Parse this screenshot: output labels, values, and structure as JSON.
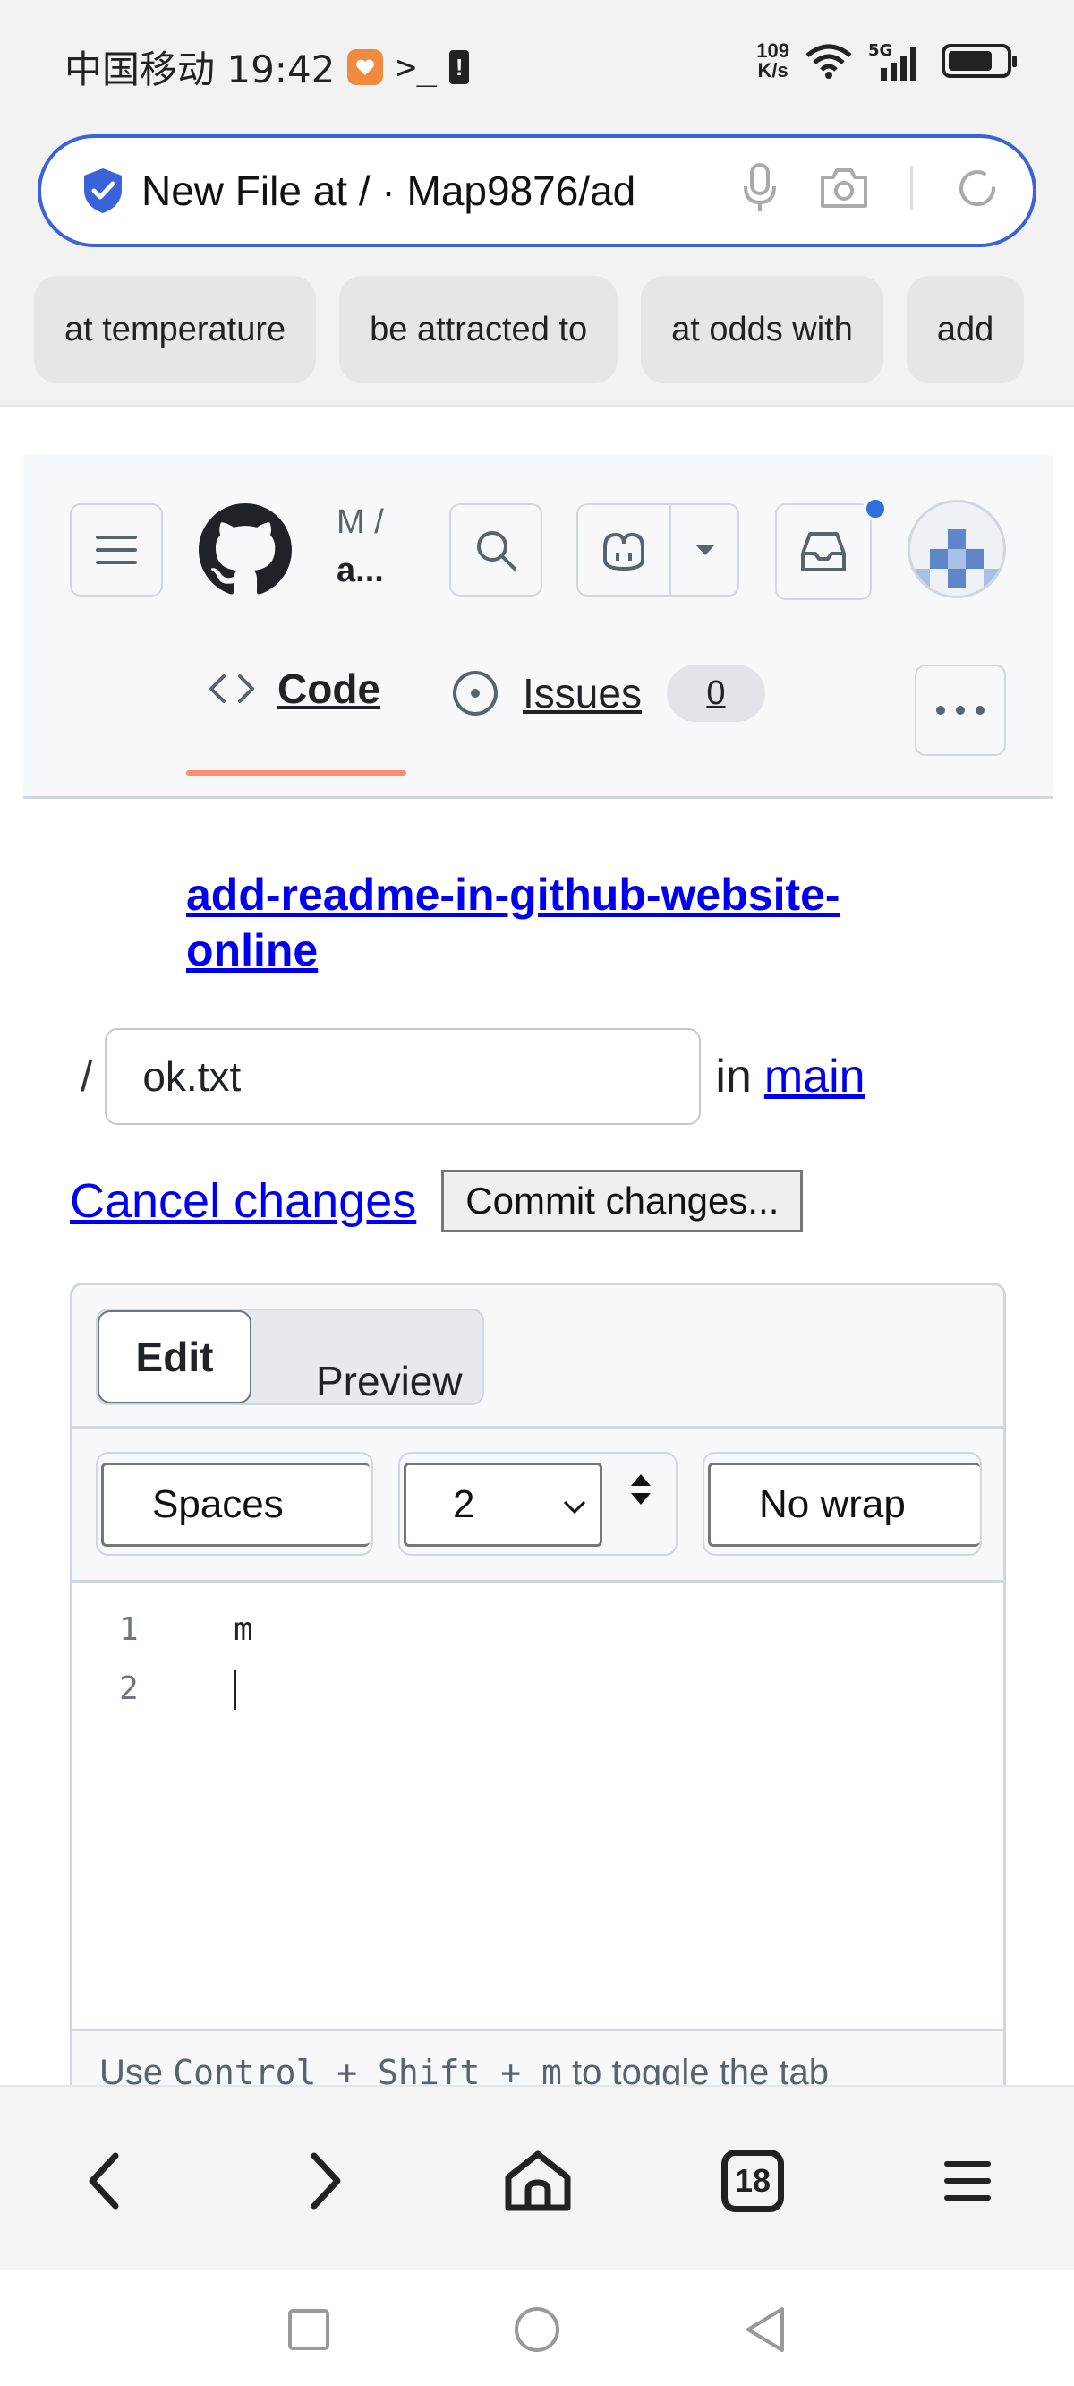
{
  "status_bar": {
    "carrier_time": "中国移动 19:42",
    "terminal_glyph": ">_",
    "net_speed_value": "109",
    "net_speed_unit": "K/s",
    "network_type": "5G"
  },
  "browser": {
    "url_text": "New File at / · Map9876/ad",
    "suggestions": [
      "at temperature",
      "be attracted to",
      "at odds with",
      "add"
    ]
  },
  "github": {
    "owner": "M /",
    "repo": "a...",
    "tabs": [
      {
        "label": "Code"
      },
      {
        "label": "Issues",
        "count": "0"
      }
    ]
  },
  "editor_page": {
    "branch_link": "add-readme-in-github-website-online",
    "path_slash": "/",
    "filename": "ok.txt",
    "in_text": "in",
    "branch_name": "main",
    "cancel_label": "Cancel changes",
    "commit_label": "Commit changes...",
    "edit_tab": "Edit",
    "preview_tab": "Preview",
    "indent_mode": "Spaces",
    "indent_size": "2",
    "wrap_mode": "No wrap",
    "lines": [
      {
        "num": "1",
        "text": "m"
      },
      {
        "num": "2",
        "text": ""
      }
    ],
    "footer_pre": "Use ",
    "footer_keys": "Control + Shift + m",
    "footer_post": " to toggle the tab"
  },
  "colors": {
    "accent_blue": "#3b63d9",
    "tab_underline": "#fd8c73",
    "link": "#0000ee"
  }
}
